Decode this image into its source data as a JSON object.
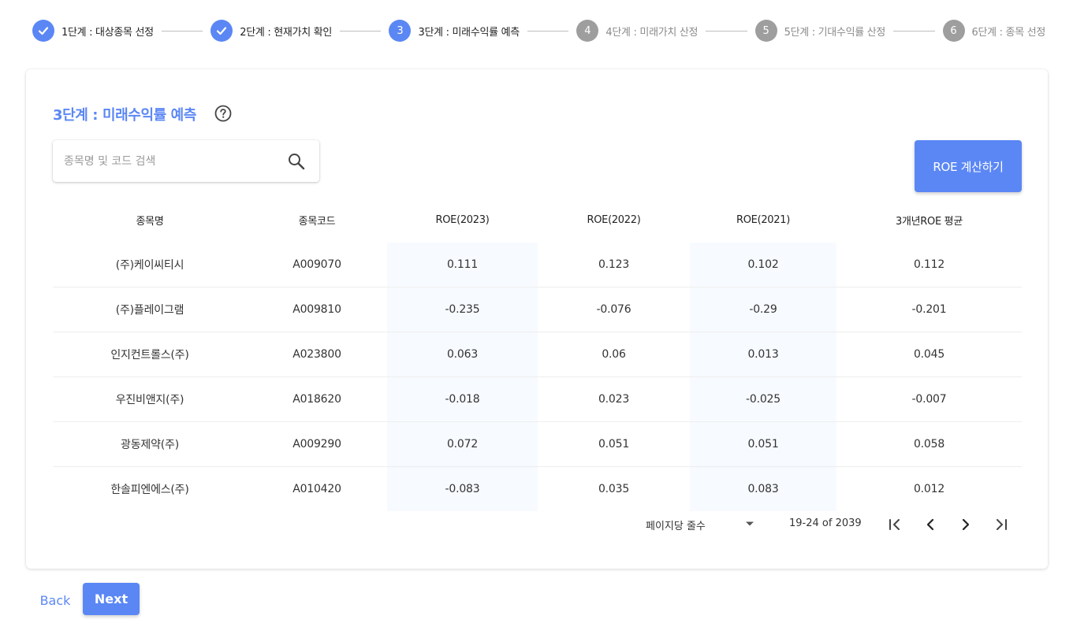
{
  "colors": {
    "primary": "#5b87f5",
    "step_inactive": "#9e9e9e",
    "column_shade": "#f7fafe"
  },
  "stepper": {
    "steps": [
      {
        "marker": "check-icon",
        "number": "1",
        "label": "1단계 : 대상종목 선정",
        "status": "done"
      },
      {
        "marker": "check-icon",
        "number": "2",
        "label": "2단계 : 현재가치 확인",
        "status": "done"
      },
      {
        "marker": "number",
        "number": "3",
        "label": "3단계 : 미래수익률 예측",
        "status": "active"
      },
      {
        "marker": "number",
        "number": "4",
        "label": "4단계 : 미래가치 산정",
        "status": "todo"
      },
      {
        "marker": "number",
        "number": "5",
        "label": "5단계 : 기대수익률 산정",
        "status": "todo"
      },
      {
        "marker": "number",
        "number": "6",
        "label": "6단계 : 종목 선정",
        "status": "todo"
      }
    ]
  },
  "card": {
    "title": "3단계 : 미래수익률 예측",
    "help_icon": "help-circle-icon"
  },
  "search": {
    "placeholder": "종목명 및 코드 검색",
    "value": "",
    "icon": "search-icon"
  },
  "actions": {
    "roe_button": "ROE 계산하기",
    "back": "Back",
    "next": "Next"
  },
  "table": {
    "columns": [
      "종목명",
      "종목코드",
      "ROE(2023)",
      "ROE(2022)",
      "ROE(2021)",
      "3개년ROE 평균"
    ],
    "rows": [
      [
        "(주)케이씨티시",
        "A009070",
        "0.111",
        "0.123",
        "0.102",
        "0.112"
      ],
      [
        "(주)플레이그램",
        "A009810",
        "-0.235",
        "-0.076",
        "-0.29",
        "-0.201"
      ],
      [
        "인지컨트롤스(주)",
        "A023800",
        "0.063",
        "0.06",
        "0.013",
        "0.045"
      ],
      [
        "우진비앤지(주)",
        "A018620",
        "-0.018",
        "0.023",
        "-0.025",
        "-0.007"
      ],
      [
        "광동제약(주)",
        "A009290",
        "0.072",
        "0.051",
        "0.051",
        "0.058"
      ],
      [
        "한솔피엔에스(주)",
        "A010420",
        "-0.083",
        "0.035",
        "0.083",
        "0.012"
      ]
    ]
  },
  "pagination": {
    "rows_per_page_label": "페이지당 줄수",
    "rows_per_page_value": "",
    "range": "19-24 of 2039",
    "icons": [
      "first-page-icon",
      "prev-page-icon",
      "next-page-icon",
      "last-page-icon"
    ]
  }
}
